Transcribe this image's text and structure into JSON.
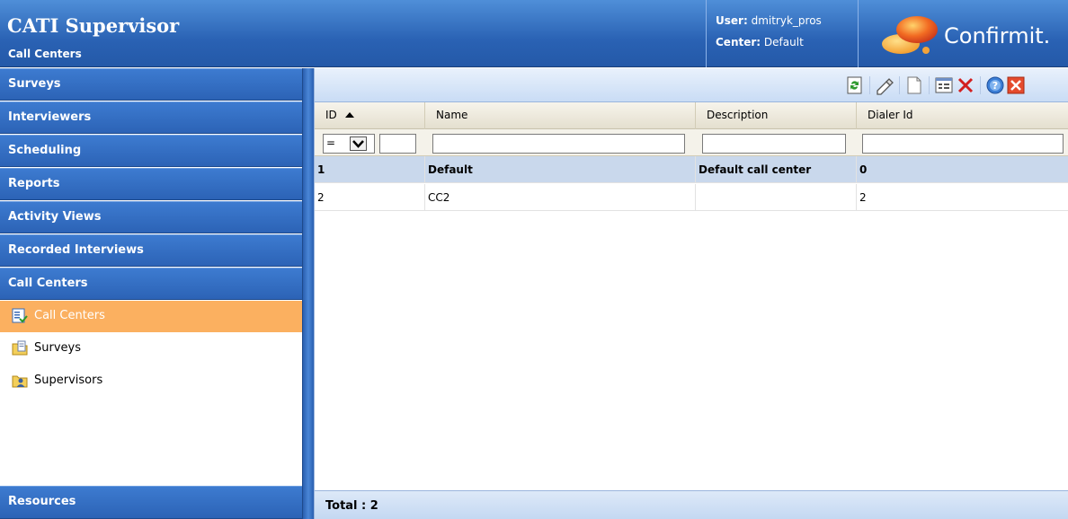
{
  "header": {
    "title": "CATI Supervisor",
    "subtitle": "Call Centers",
    "user_label": "User:",
    "user_value": "dmitryk_pros",
    "center_label": "Center:",
    "center_value": "Default",
    "logo_text": "Confirmit."
  },
  "sidebar": {
    "sections": [
      {
        "label": "Surveys"
      },
      {
        "label": "Interviewers"
      },
      {
        "label": "Scheduling"
      },
      {
        "label": "Reports"
      },
      {
        "label": "Activity Views"
      },
      {
        "label": "Recorded Interviews"
      },
      {
        "label": "Call Centers"
      }
    ],
    "sub_items": [
      {
        "label": "Call Centers",
        "icon": "call-centers-icon",
        "active": true
      },
      {
        "label": "Surveys",
        "icon": "folder-document-icon",
        "active": false
      },
      {
        "label": "Supervisors",
        "icon": "folder-user-icon",
        "active": false
      }
    ],
    "bottom_section": "Resources"
  },
  "toolbar": {
    "buttons": [
      "refresh-icon",
      "edit-icon",
      "new-icon",
      "properties-icon",
      "delete-icon",
      "help-icon",
      "close-icon"
    ]
  },
  "grid": {
    "columns": [
      "ID",
      "Name",
      "Description",
      "Dialer Id"
    ],
    "sort_column": "ID",
    "filter": {
      "operator": "=",
      "id_value": "",
      "name_value": "",
      "description_value": "",
      "dialer_value": ""
    },
    "rows": [
      {
        "id": "1",
        "name": "Default",
        "description": "Default call center",
        "dialer_id": "0",
        "selected": true
      },
      {
        "id": "2",
        "name": "CC2",
        "description": "",
        "dialer_id": "2",
        "selected": false
      }
    ]
  },
  "footer": {
    "total_label": "Total : 2"
  },
  "colors": {
    "header_blue": "#2a62b4",
    "active_orange": "#fbb060",
    "selected_row": "#c9d8ec"
  }
}
